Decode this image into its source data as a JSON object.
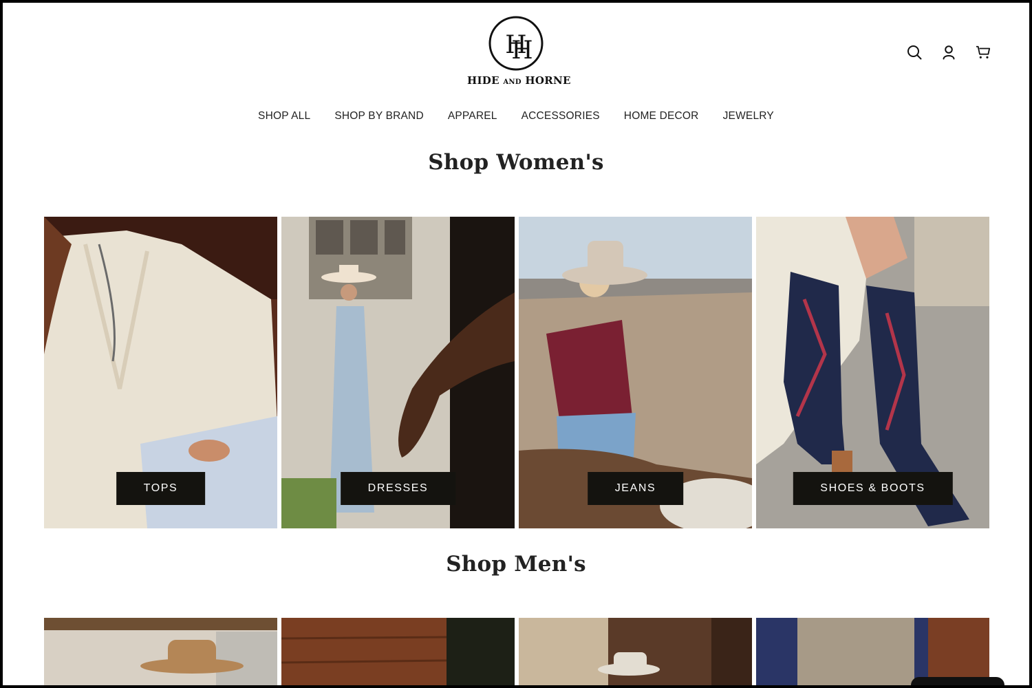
{
  "brand": {
    "monogram": "HH",
    "name_main": "HIDE",
    "name_small": "AND",
    "name_end": "HORNE"
  },
  "header": {
    "icons": [
      "search-icon",
      "account-icon",
      "cart-icon"
    ]
  },
  "nav": [
    "SHOP ALL",
    "SHOP BY BRAND",
    "APPAREL",
    "ACCESSORIES",
    "HOME DECOR",
    "JEWELRY"
  ],
  "women": {
    "title": "Shop Women's",
    "tiles": [
      {
        "label": "TOPS"
      },
      {
        "label": "DRESSES"
      },
      {
        "label": "JEANS"
      },
      {
        "label": "SHOES & BOOTS"
      }
    ]
  },
  "men": {
    "title": "Shop Men's"
  },
  "colors": {
    "label_bg": "#14130f",
    "text": "#222222",
    "page_bg": "#ffffff"
  }
}
